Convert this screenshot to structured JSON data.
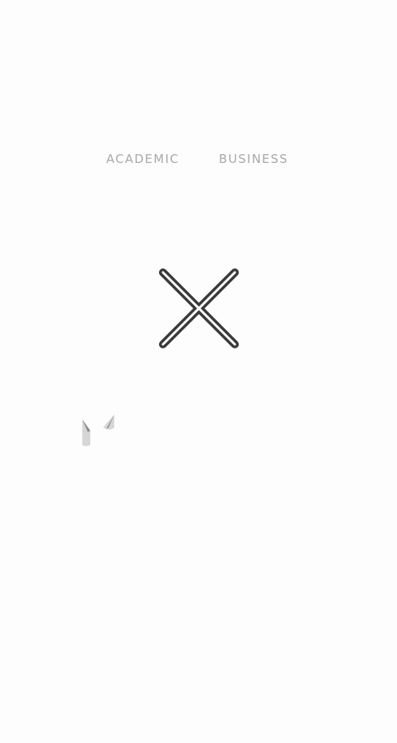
{
  "nav": {
    "items": [
      {
        "label": "ACADEMIC"
      },
      {
        "label": "BUSINESS"
      }
    ]
  },
  "close_button": {
    "icon": "close-icon"
  },
  "logo": {
    "icon": "logo-icon"
  },
  "colors": {
    "background": "#fdfdfd",
    "nav_text": "#a8a8a8",
    "close_outline": "#3a3a3a",
    "logo_light": "#d6d6d6",
    "logo_dark": "#8c8c8c"
  }
}
